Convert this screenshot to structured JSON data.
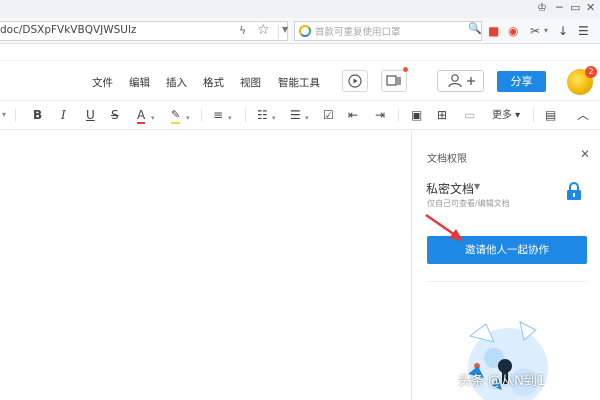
{
  "browser": {
    "url": "doc/DSXpFVkVBQVJWSUlz",
    "search_placeholder": "首款可重复使用口罩"
  },
  "menu": {
    "items": [
      "文件",
      "编辑",
      "插入",
      "格式",
      "视图",
      "智能工具"
    ],
    "share_label": "分享",
    "notification_count": "2"
  },
  "format_bar": {
    "more_label": "更多"
  },
  "permissions_panel": {
    "title": "文档权限",
    "mode_label": "私密文档",
    "mode_description": "仅自己可查看/编辑文档",
    "invite_button": "邀请他人一起协作"
  },
  "watermark": "头条 @从N到1",
  "colors": {
    "primary": "#1e88e5",
    "font_color_underline": "#e53935",
    "highlight_underline": "#fdd835"
  }
}
